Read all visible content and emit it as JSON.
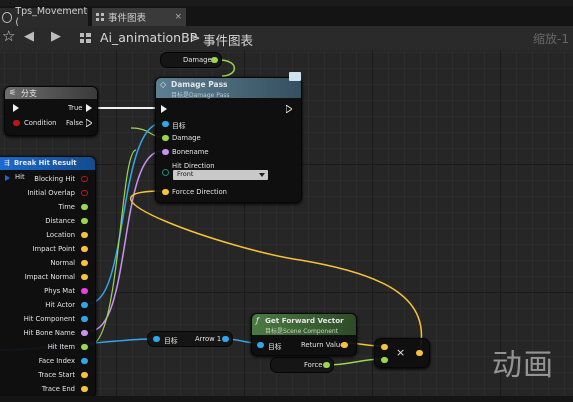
{
  "tabs": [
    {
      "label": "Tps_Movement (",
      "close": "×"
    },
    {
      "label": "事件图表",
      "close": "×"
    }
  ],
  "breadcrumb": {
    "title": "Ai_animationBP",
    "sep": ">",
    "graph": "事件图表",
    "zoom": "缩放-1"
  },
  "nodes": {
    "damage_var": {
      "label": "Damage"
    },
    "branch": {
      "title": "分支",
      "true": "True",
      "condition": "Condition",
      "false": "False"
    },
    "damage_pass": {
      "title": "Damage Pass",
      "subtitle": "目标是Damage Pass",
      "target": "目标",
      "damage": "Damage",
      "bonename": "Bonename",
      "hit_direction": "Hit Direction",
      "direction_value": "Front",
      "force_direction": "Forcce Direction"
    },
    "break_hit": {
      "title": "Break Hit Result",
      "hit": "Hit",
      "pins": [
        "Blocking Hit",
        "Initial Overlap",
        "Time",
        "Distance",
        "Location",
        "Impact Point",
        "Normal",
        "Impact Normal",
        "Phys Mat",
        "Hit Actor",
        "Hit Component",
        "Hit Bone Name",
        "Hit Item",
        "Face Index",
        "Trace Start",
        "Trace End"
      ]
    },
    "arrow_get": {
      "target": "目标",
      "label": "Arrow 1"
    },
    "forward": {
      "title": "Get Forward Vector",
      "subtitle": "目标是Scene Component",
      "target": "目标",
      "return": "Return Value"
    },
    "force_var": {
      "label": "Force"
    },
    "multiply": {
      "label": "×"
    }
  },
  "watermark": "动画",
  "colors": {
    "exec": "#f0f0f0",
    "red": "#c21414",
    "float": "#9bd64e",
    "vector": "#f7c23a",
    "object": "#2fa7ec",
    "name": "#c892f0",
    "string": "#ee40e0",
    "struct": "#1c6ad6"
  }
}
